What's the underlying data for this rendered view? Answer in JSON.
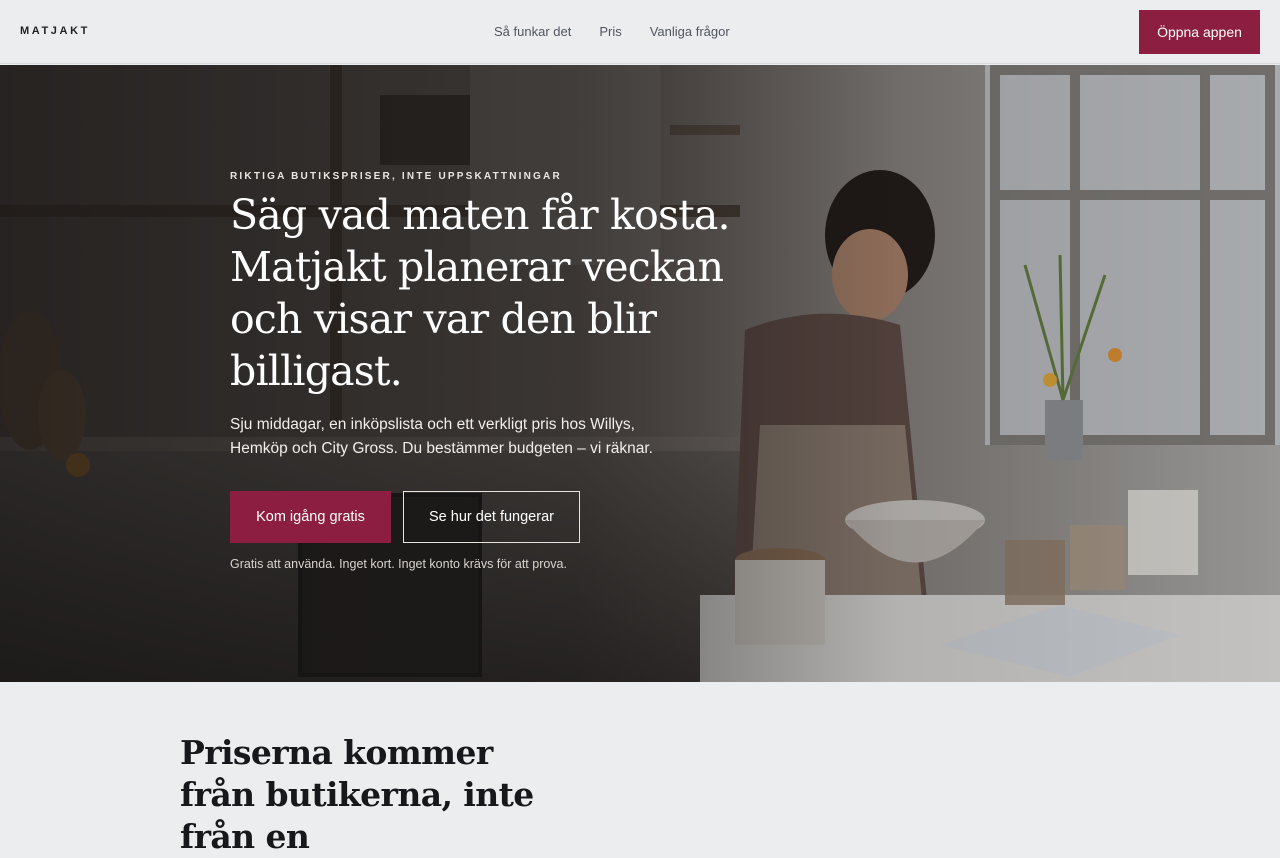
{
  "header": {
    "brand": "MATJAKT",
    "nav": [
      "Så funkar det",
      "Pris",
      "Vanliga frågor"
    ],
    "cta": "Öppna appen"
  },
  "hero": {
    "eyebrow": "RIKTIGA BUTIKSPRISER, INTE UPPSKATTNINGAR",
    "headline": "Säg vad maten får kosta. Matjakt planerar veckan och visar var den blir billigast.",
    "lede": "Sju middagar, en inköpslista och ett verkligt pris hos Willys, Hemköp och City Gross. Du bestämmer budgeten – vi räknar.",
    "primary_cta": "Kom igång gratis",
    "secondary_cta": "Se hur det fungerar",
    "note": "Gratis att använda. Inget kort. Inget konto krävs för att prova."
  },
  "section": {
    "title": "Priserna kommer från butikerna, inte från en"
  },
  "colors": {
    "accent": "#8b1e41",
    "background": "#ecedef",
    "text": "#16181b"
  }
}
